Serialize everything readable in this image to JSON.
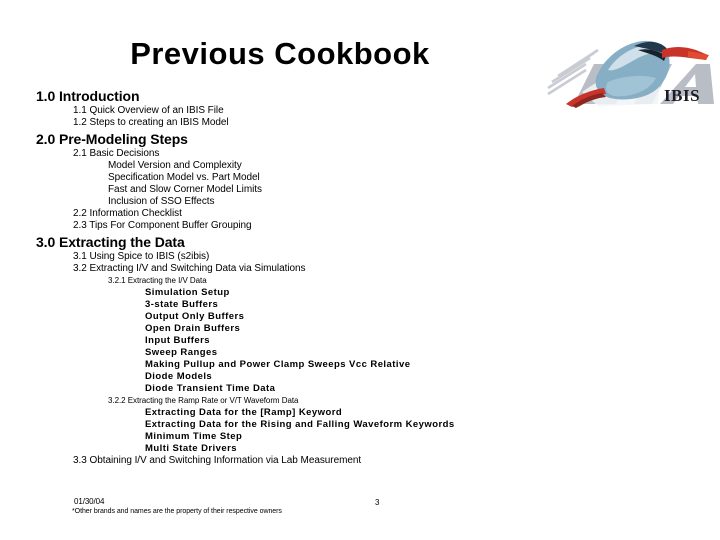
{
  "slide": {
    "title": "Previous Cookbook",
    "page_number": "3"
  },
  "logo": {
    "wordmark": "IBIS",
    "background_text": "EIA",
    "bird_body_color": "#86afc6",
    "bird_beak_color": "#c9342a",
    "eia_gray": "#b9bdc5"
  },
  "outline": [
    {
      "level": 1,
      "text": "1.0 Introduction"
    },
    {
      "level": 2,
      "text": "1.1 Quick Overview of an IBIS File"
    },
    {
      "level": 2,
      "text": "1.2 Steps to creating an IBIS Model"
    },
    {
      "level": 1,
      "text": "2.0 Pre-Modeling Steps"
    },
    {
      "level": 2,
      "text": "2.1 Basic Decisions"
    },
    {
      "level": 3,
      "text": "Model Version and Complexity"
    },
    {
      "level": 3,
      "text": "Specification Model  vs. Part Model"
    },
    {
      "level": 3,
      "text": "Fast and Slow Corner Model Limits"
    },
    {
      "level": 3,
      "text": "Inclusion of SSO Effects"
    },
    {
      "level": 2,
      "text": "2.2 Information Checklist"
    },
    {
      "level": 2,
      "text": "2.3 Tips For Component Buffer Grouping"
    },
    {
      "level": 1,
      "text": "3.0 Extracting the Data"
    },
    {
      "level": 2,
      "text": "3.1 Using Spice to IBIS (s2ibis)"
    },
    {
      "level": 2,
      "text": "3.2 Extracting I/V and Switching Data via Simulations"
    },
    {
      "level": "3s",
      "text": "3.2.1 Extracting the I/V Data"
    },
    {
      "level": "4b",
      "text": "Simulation Setup"
    },
    {
      "level": "4b",
      "text": "3-state Buffers"
    },
    {
      "level": "4b",
      "text": "Output Only Buffers"
    },
    {
      "level": "4b",
      "text": "Open Drain Buffers"
    },
    {
      "level": "4b",
      "text": "Input Buffers"
    },
    {
      "level": "4b",
      "text": "Sweep Ranges"
    },
    {
      "level": "4b",
      "text": "Making Pullup and Power Clamp Sweeps Vcc Relative"
    },
    {
      "level": "4b",
      "text": "Diode Models"
    },
    {
      "level": "4b",
      "text": "Diode Transient Time Data"
    },
    {
      "level": "3s",
      "text": "3.2.2 Extracting the Ramp Rate or V/T Waveform Data"
    },
    {
      "level": "4b",
      "text": "Extracting Data for the [Ramp] Keyword"
    },
    {
      "level": "4b",
      "text": "Extracting Data for the Rising and Falling Waveform Keywords"
    },
    {
      "level": "4b",
      "text": "Minimum Time Step"
    },
    {
      "level": "4b",
      "text": "Multi State Drivers"
    },
    {
      "level": 2,
      "text": "3.3 Obtaining I/V and Switching Information via Lab Measurement"
    }
  ],
  "footer": {
    "date": "01/30/04",
    "note": "*Other brands and names are the property of their respective owners"
  }
}
